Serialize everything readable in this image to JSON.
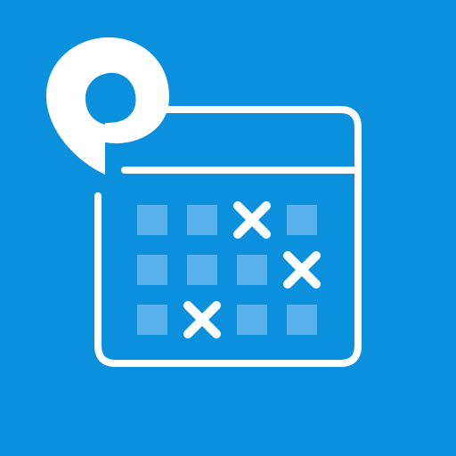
{
  "icon": {
    "semantic": "calendar-schedule-app-icon",
    "colors": {
      "background": "#0a90dc",
      "foreground": "#ffffff",
      "cell": "#5ab2ec"
    },
    "grid": {
      "rows": 3,
      "columns": 4,
      "cells": [
        [
          "empty",
          "empty",
          "marked",
          "empty"
        ],
        [
          "empty",
          "empty",
          "empty",
          "marked"
        ],
        [
          "empty",
          "marked",
          "empty",
          "empty"
        ]
      ]
    }
  }
}
